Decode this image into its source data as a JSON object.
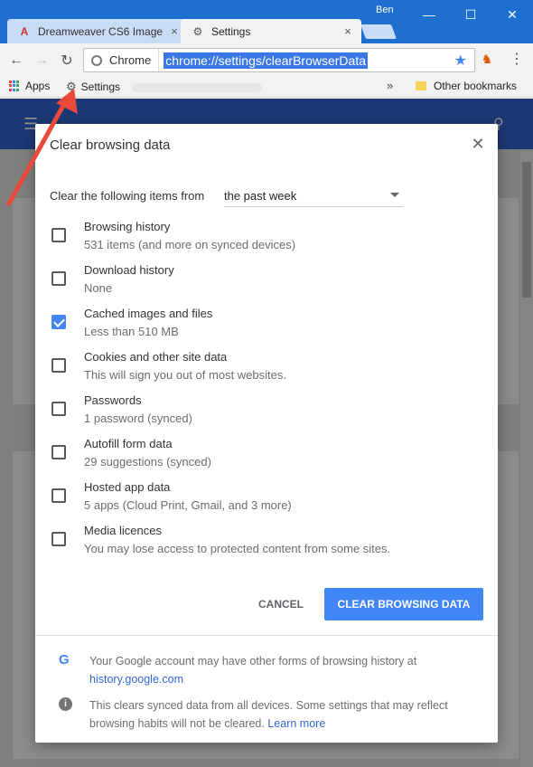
{
  "window": {
    "profile_name": "Ben",
    "controls": [
      "—",
      "☐",
      "✕"
    ]
  },
  "tabs": [
    {
      "label": "Dreamweaver CS6 Image",
      "close": "×"
    },
    {
      "label": "Settings",
      "close": "×"
    }
  ],
  "toolbar": {
    "chip_label": "Chrome",
    "url": "chrome://settings/clearBrowserData"
  },
  "bookmarks": {
    "apps_label": "Apps",
    "settings_label": "Settings",
    "overflow": "»",
    "other_label": "Other bookmarks"
  },
  "dialog": {
    "title": "Clear browsing data",
    "close": "✕",
    "range_label": "Clear the following items from",
    "range_value": "the past week",
    "items": [
      {
        "title": "Browsing history",
        "sub": "531 items (and more on synced devices)",
        "checked": false
      },
      {
        "title": "Download history",
        "sub": "None",
        "checked": false
      },
      {
        "title": "Cached images and files",
        "sub": "Less than 510 MB",
        "checked": true
      },
      {
        "title": "Cookies and other site data",
        "sub": "This will sign you out of most websites.",
        "checked": false
      },
      {
        "title": "Passwords",
        "sub": "1 password (synced)",
        "checked": false
      },
      {
        "title": "Autofill form data",
        "sub": "29 suggestions (synced)",
        "checked": false
      },
      {
        "title": "Hosted app data",
        "sub": "5 apps (Cloud Print, Gmail, and 3 more)",
        "checked": false
      },
      {
        "title": "Media licences",
        "sub": "You may lose access to protected content from some sites.",
        "checked": false
      }
    ],
    "cancel_label": "CANCEL",
    "clear_label": "CLEAR BROWSING DATA",
    "footer": {
      "google_text": "Your Google account may have other forms of browsing history at",
      "google_link": "history.google.com",
      "info_text": "This clears synced data from all devices. Some settings that may reflect browsing habits will not be cleared.",
      "learn_more": "Learn more"
    }
  },
  "colors": {
    "accent": "#4285f4",
    "header": "#3367d6",
    "annotation_arrow": "#e8493a"
  }
}
